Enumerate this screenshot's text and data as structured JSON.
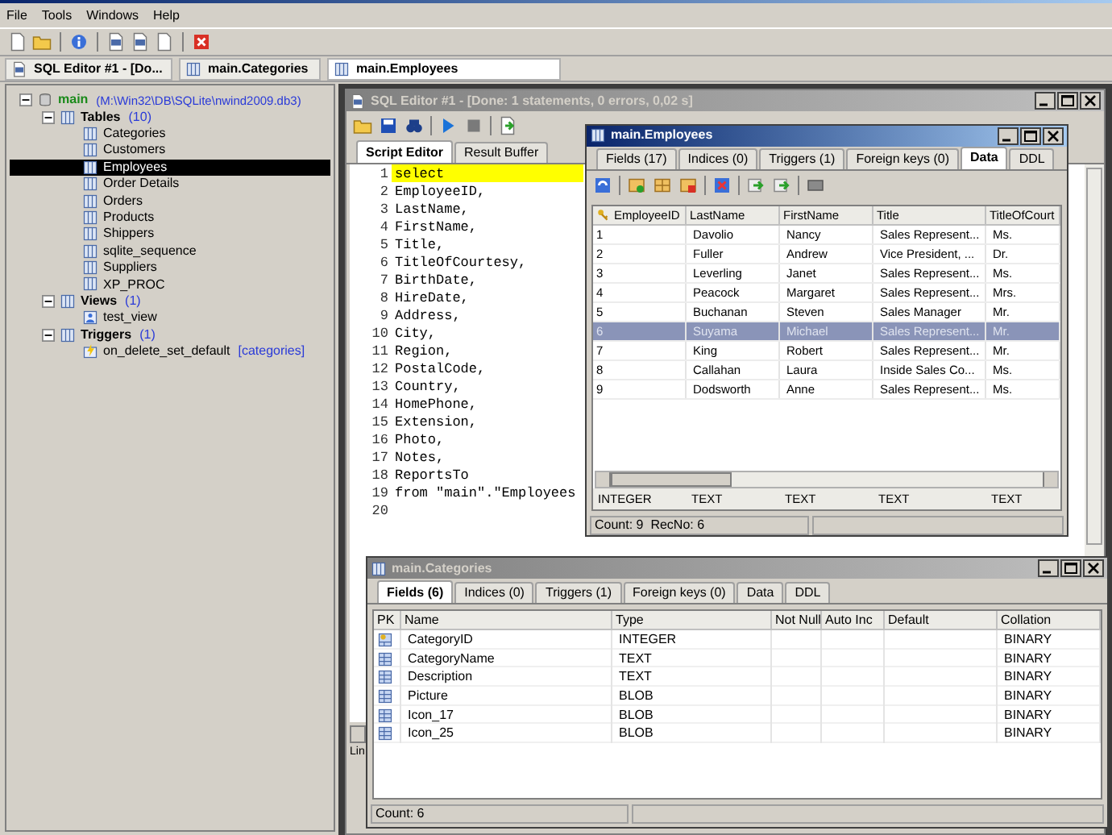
{
  "menu": [
    "File",
    "Tools",
    "Windows",
    "Help"
  ],
  "doc_tabs": [
    {
      "label": "SQL Editor #1 - [Do...",
      "kind": "sql",
      "selected": false
    },
    {
      "label": "main.Categories",
      "kind": "table",
      "selected": false
    },
    {
      "label": "main.Employees",
      "kind": "table",
      "selected": true
    }
  ],
  "tree": [
    {
      "label": "main",
      "kind": "database",
      "note": "(M:\\Win32\\DB\\SQLite\\nwind2009.db3)",
      "expanded": true,
      "selected": false,
      "children": [
        {
          "label": "Tables",
          "kind": "group",
          "count": "(10)",
          "expanded": true,
          "selected": false,
          "children": [
            {
              "label": "Categories",
              "kind": "table",
              "selected": false
            },
            {
              "label": "Customers",
              "kind": "table",
              "selected": false
            },
            {
              "label": "Employees",
              "kind": "table",
              "selected": true
            },
            {
              "label": "Order Details",
              "kind": "table",
              "selected": false
            },
            {
              "label": "Orders",
              "kind": "table",
              "selected": false
            },
            {
              "label": "Products",
              "kind": "table",
              "selected": false
            },
            {
              "label": "Shippers",
              "kind": "table",
              "selected": false
            },
            {
              "label": "sqlite_sequence",
              "kind": "table",
              "selected": false
            },
            {
              "label": "Suppliers",
              "kind": "table",
              "selected": false
            },
            {
              "label": "XP_PROC",
              "kind": "table",
              "selected": false
            }
          ]
        },
        {
          "label": "Views",
          "kind": "group",
          "count": "(1)",
          "expanded": true,
          "selected": false,
          "children": [
            {
              "label": "test_view",
              "kind": "view",
              "selected": false
            }
          ]
        },
        {
          "label": "Triggers",
          "kind": "group",
          "count": "(1)",
          "expanded": true,
          "selected": false,
          "children": [
            {
              "label": "on_delete_set_default",
              "kind": "trigger",
              "note": "[categories]",
              "selected": false
            }
          ]
        }
      ]
    }
  ],
  "sql_editor": {
    "title": "SQL Editor #1 - [Done: 1 statements, 0 errors, 0,02 s]",
    "active": false,
    "tabs": [
      {
        "label": "Script Editor",
        "selected": true
      },
      {
        "label": "Result Buffer",
        "selected": false
      }
    ],
    "lines": [
      {
        "number": "1",
        "text": "select",
        "highlighted": true
      },
      {
        "number": "2",
        "text": "EmployeeID,",
        "highlighted": false
      },
      {
        "number": "3",
        "text": "LastName,",
        "highlighted": false
      },
      {
        "number": "4",
        "text": "FirstName,",
        "highlighted": false
      },
      {
        "number": "5",
        "text": "Title,",
        "highlighted": false
      },
      {
        "number": "6",
        "text": "TitleOfCourtesy,",
        "highlighted": false
      },
      {
        "number": "7",
        "text": "BirthDate,",
        "highlighted": false
      },
      {
        "number": "8",
        "text": "HireDate,",
        "highlighted": false
      },
      {
        "number": "9",
        "text": "Address,",
        "highlighted": false
      },
      {
        "number": "10",
        "text": "City,",
        "highlighted": false
      },
      {
        "number": "11",
        "text": "Region,",
        "highlighted": false
      },
      {
        "number": "12",
        "text": "PostalCode,",
        "highlighted": false
      },
      {
        "number": "13",
        "text": "Country,",
        "highlighted": false
      },
      {
        "number": "14",
        "text": "HomePhone,",
        "highlighted": false
      },
      {
        "number": "15",
        "text": "Extension,",
        "highlighted": false
      },
      {
        "number": "16",
        "text": "Photo,",
        "highlighted": false
      },
      {
        "number": "17",
        "text": "Notes,",
        "highlighted": false
      },
      {
        "number": "18",
        "text": "ReportsTo",
        "highlighted": false
      },
      {
        "number": "19",
        "text": "from \"main\".\"Employees",
        "highlighted": false
      },
      {
        "number": "20",
        "highlighted": false
      }
    ],
    "status": "Lin"
  },
  "employees_window": {
    "title": "main.Employees",
    "active": true,
    "tabs": [
      {
        "label": "Fields (17)",
        "selected": false
      },
      {
        "label": "Indices (0)",
        "selected": false
      },
      {
        "label": "Triggers (1)",
        "selected": false
      },
      {
        "label": "Foreign keys (0)",
        "selected": false
      },
      {
        "label": "Data",
        "selected": true
      },
      {
        "label": "DDL",
        "selected": false
      }
    ],
    "columns": [
      {
        "label": "EmployeeID",
        "primary_key": true
      },
      {
        "label": "LastName",
        "primary_key": false
      },
      {
        "label": "FirstName",
        "primary_key": false
      },
      {
        "label": "Title",
        "primary_key": false
      },
      {
        "label": "TitleOfCourt",
        "primary_key": false
      }
    ],
    "rows": [
      {
        "cells": [
          "1",
          "Davolio",
          "Nancy",
          "Sales Represent...",
          "Ms."
        ],
        "selected": false
      },
      {
        "cells": [
          "2",
          "Fuller",
          "Andrew",
          "Vice President, ...",
          "Dr."
        ],
        "selected": false
      },
      {
        "cells": [
          "3",
          "Leverling",
          "Janet",
          "Sales Represent...",
          "Ms."
        ],
        "selected": false
      },
      {
        "cells": [
          "4",
          "Peacock",
          "Margaret",
          "Sales Represent...",
          "Mrs."
        ],
        "selected": false
      },
      {
        "cells": [
          "5",
          "Buchanan",
          "Steven",
          "Sales Manager",
          "Mr."
        ],
        "selected": false
      },
      {
        "cells": [
          "6",
          "Suyama",
          "Michael",
          "Sales Represent...",
          "Mr."
        ],
        "selected": true
      },
      {
        "cells": [
          "7",
          "King",
          "Robert",
          "Sales Represent...",
          "Mr."
        ],
        "selected": false
      },
      {
        "cells": [
          "8",
          "Callahan",
          "Laura",
          "Inside Sales Co...",
          "Ms."
        ],
        "selected": false
      },
      {
        "cells": [
          "9",
          "Dodsworth",
          "Anne",
          "Sales Represent...",
          "Ms."
        ],
        "selected": false
      }
    ],
    "column_types": [
      "INTEGER",
      "TEXT",
      "TEXT",
      "TEXT",
      "TEXT"
    ],
    "status": "Count: 9  RecNo: 6"
  },
  "categories_window": {
    "title": "main.Categories",
    "active": false,
    "tabs": [
      {
        "label": "Fields (6)",
        "selected": true
      },
      {
        "label": "Indices (0)",
        "selected": false
      },
      {
        "label": "Triggers (1)",
        "selected": false
      },
      {
        "label": "Foreign keys (0)",
        "selected": false
      },
      {
        "label": "Data",
        "selected": false
      },
      {
        "label": "DDL",
        "selected": false
      }
    ],
    "columns": [
      "PK",
      "Name",
      "Type",
      "Not Null",
      "Auto Inc",
      "Default",
      "Collation"
    ],
    "rows": [
      {
        "primary_key": true,
        "name": "CategoryID",
        "type": "INTEGER",
        "collation": "BINARY"
      },
      {
        "primary_key": false,
        "name": "CategoryName",
        "type": "TEXT",
        "collation": "BINARY"
      },
      {
        "primary_key": false,
        "name": "Description",
        "type": "TEXT",
        "collation": "BINARY"
      },
      {
        "primary_key": false,
        "name": "Picture",
        "type": "BLOB",
        "collation": "BINARY"
      },
      {
        "primary_key": false,
        "name": "Icon_17",
        "type": "BLOB",
        "collation": "BINARY"
      },
      {
        "primary_key": false,
        "name": "Icon_25",
        "type": "BLOB",
        "collation": "BINARY"
      }
    ],
    "status": "Count: 6"
  }
}
